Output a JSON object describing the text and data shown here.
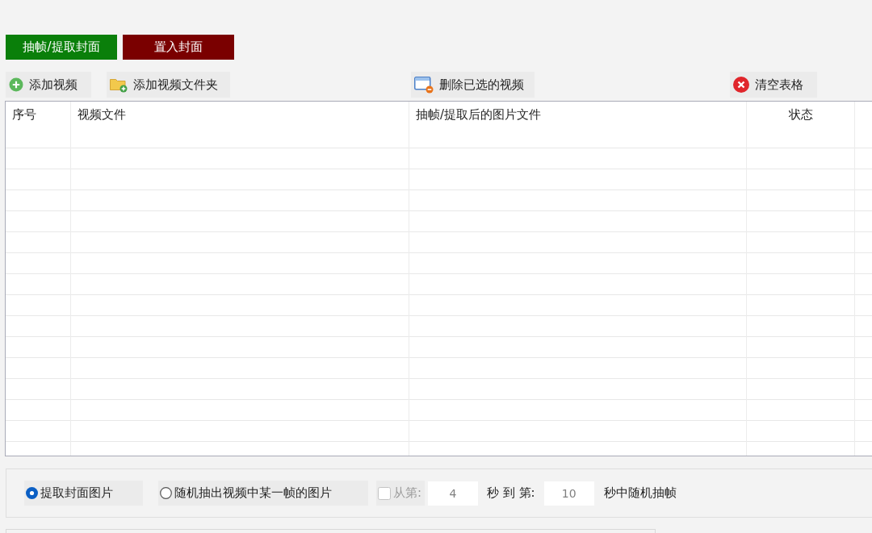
{
  "mode_buttons": [
    {
      "label": "抽帧/提取封面",
      "color": "#0a7f0a"
    },
    {
      "label": "置入封面",
      "color": "#7a0000"
    }
  ],
  "toolbar": [
    {
      "label": "添加视频",
      "kind": "add"
    },
    {
      "label": "添加视频文件夹",
      "kind": "folder"
    },
    {
      "label": "删除已选的视频",
      "kind": "remove"
    },
    {
      "label": "清空表格",
      "kind": "clear"
    }
  ],
  "table": {
    "columns": [
      "序号",
      "视频文件",
      "抽帧/提取后的图片文件",
      "状态"
    ]
  },
  "options": {
    "radios": [
      {
        "label": "提取封面图片",
        "selected": true
      },
      {
        "label": "随机抽出视频中某一帧的图片",
        "selected": false
      }
    ],
    "range": {
      "checkbox": {
        "label": "从第:",
        "checked": false,
        "disabled": true
      },
      "from": {
        "value": "4",
        "disabled": true
      },
      "middle": "秒 到 第:",
      "to": {
        "value": "10",
        "disabled": true
      },
      "suffix": "秒中随机抽帧"
    }
  }
}
